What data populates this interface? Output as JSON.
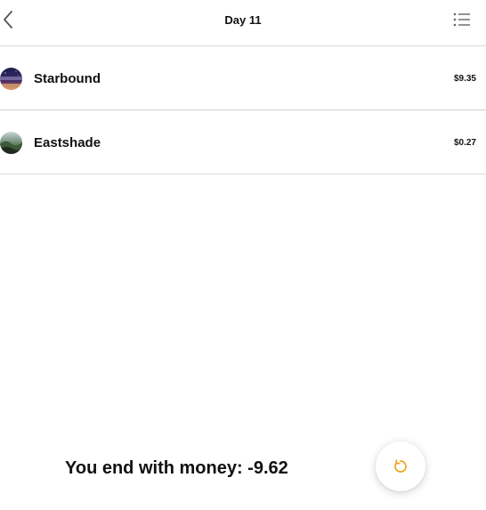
{
  "header": {
    "title": "Day 11",
    "back_icon": "chevron-left-icon",
    "menu_icon": "list-icon"
  },
  "items": [
    {
      "name": "Starbound",
      "price": "$9.35",
      "icon": "starbound-game-thumbnail"
    },
    {
      "name": "Eastshade",
      "price": "$0.27",
      "icon": "eastshade-game-thumbnail"
    }
  ],
  "summary": {
    "text": "You end with money: -9.62"
  },
  "fab": {
    "icon": "refresh-icon",
    "accent_color": "#f0a21a"
  }
}
